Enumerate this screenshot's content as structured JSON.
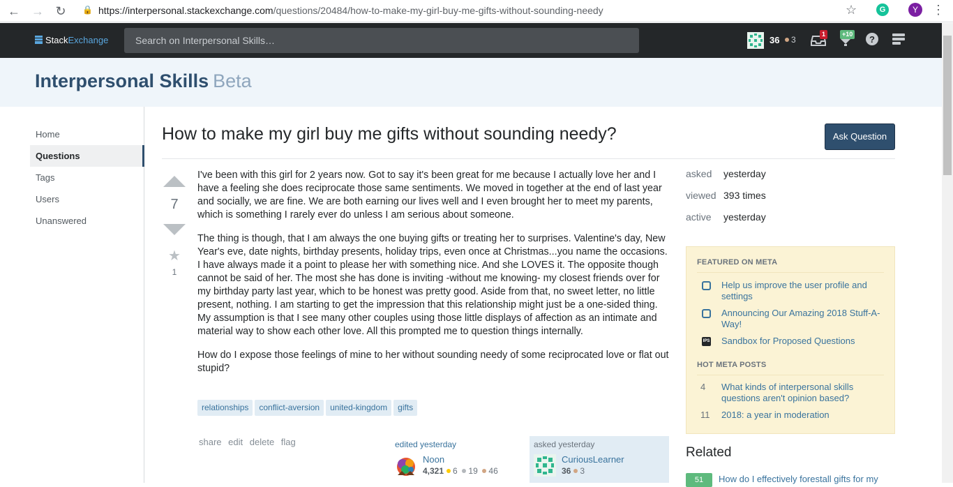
{
  "browser": {
    "url_host": "https://interpersonal.stackexchange.com",
    "url_path": "/questions/20484/how-to-make-my-girl-buy-me-gifts-without-sounding-needy",
    "extension_label": "G",
    "profile_initial": "Y"
  },
  "topbar": {
    "logo_stack": "Stack",
    "logo_exchange": "Exchange",
    "search_placeholder": "Search on Interpersonal Skills…",
    "rep": "36",
    "bronze_badges": "3",
    "inbox_count": "1",
    "achievements_count": "+10"
  },
  "site": {
    "name": "Interpersonal Skills",
    "beta": "Beta"
  },
  "nav": {
    "items": [
      "Home",
      "Questions",
      "Tags",
      "Users",
      "Unanswered"
    ],
    "active": "Questions"
  },
  "question": {
    "title": "How to make my girl buy me gifts without sounding needy?",
    "ask_button": "Ask Question",
    "votes": "7",
    "favorites": "1",
    "paragraphs": [
      "I've been with this girl for 2 years now. Got to say it's been great for me because I actually love her and I have a feeling she does reciprocate those same sentiments. We moved in together at the end of last year and socially, we are fine. We are both earning our lives well and I even brought her to meet my parents, which is something I rarely ever do unless I am serious about someone.",
      "The thing is though, that I am always the one buying gifts or treating her to surprises. Valentine's day, New Year's eve, date nights, birthday presents, holiday trips, even once at Christmas...you name the occasions. I have always made it a point to please her with something nice. And she LOVES it. The opposite though cannot be said of her. The most she has done is inviting -without me knowing- my closest friends over for my birthday party last year, which to be honest was pretty good. Aside from that, no sweet letter, no little present, nothing. I am starting to get the impression that this relationship might just be a one-sided thing. My assumption is that I see many other couples using those little displays of affection as an intimate and material way to show each other love. All this prompted me to question things internally.",
      "How do I expose those feelings of mine to her without sounding needy of some reciprocated love or flat out stupid?"
    ],
    "tags": [
      "relationships",
      "conflict-aversion",
      "united-kingdom",
      "gifts"
    ],
    "menu": [
      "share",
      "edit",
      "delete",
      "flag"
    ],
    "edited": {
      "time": "edited yesterday",
      "name": "Noon",
      "rep": "4,321",
      "gold": "6",
      "silver": "19",
      "bronze": "46"
    },
    "asked": {
      "time": "asked yesterday",
      "name": "CuriousLearner",
      "rep": "36",
      "bronze": "3"
    }
  },
  "stats": [
    {
      "label": "asked",
      "value": "yesterday"
    },
    {
      "label": "viewed",
      "value": "393 times"
    },
    {
      "label": "active",
      "value": "yesterday"
    }
  ],
  "meta": {
    "featured_heading": "FEATURED ON META",
    "featured": [
      {
        "icon": "bubble",
        "text": "Help us improve the user profile and settings"
      },
      {
        "icon": "bubble",
        "text": "Announcing Our Amazing 2018 Stuff-A-Way!"
      },
      {
        "icon": "ips",
        "text": "Sandbox for Proposed Questions"
      }
    ],
    "hot_heading": "HOT META POSTS",
    "hot": [
      {
        "score": "4",
        "text": "What kinds of interpersonal skills questions aren't opinion based?"
      },
      {
        "score": "11",
        "text": "2018: a year in moderation"
      }
    ]
  },
  "related": {
    "heading": "Related",
    "first_score": "51",
    "first_text": "How do I effectively forestall gifts for my"
  },
  "colors": {
    "topbar": "#242729",
    "accent": "#2f4f6e",
    "link": "#39739d",
    "tag_bg": "#e1ecf4",
    "meta_bg": "#fbf3d5",
    "gold": "#ffcc01",
    "silver": "#b4b8bc",
    "bronze": "#d1a684"
  }
}
